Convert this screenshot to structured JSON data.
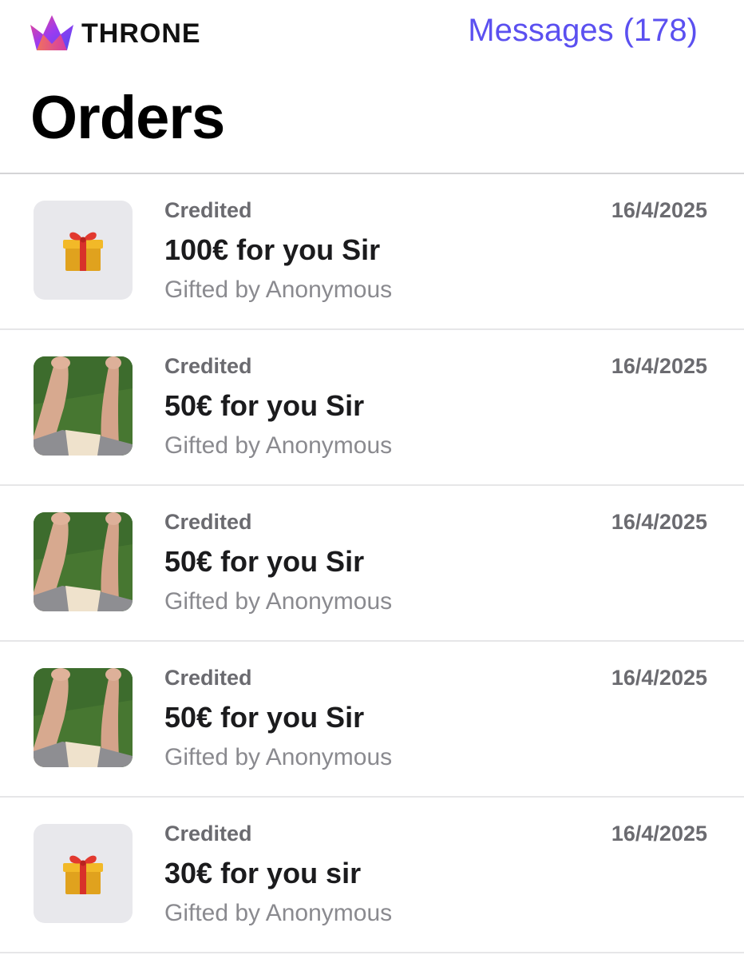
{
  "header": {
    "brand": "THRONE",
    "logo_icon": "throne-crown-logo-icon",
    "messages_label": "Messages",
    "messages_count": "(178)",
    "accent_color": "#5b50f0"
  },
  "page": {
    "title": "Orders"
  },
  "orders": [
    {
      "status": "Credited",
      "title": "100€ for you Sir",
      "gifted_by": "Gifted by Anonymous",
      "date": "16/4/2025",
      "thumbnail": "gift-icon"
    },
    {
      "status": "Credited",
      "title": "50€ for you Sir",
      "gifted_by": "Gifted by Anonymous",
      "date": "16/4/2025",
      "thumbnail": "photo-thumbnail"
    },
    {
      "status": "Credited",
      "title": "50€ for you Sir",
      "gifted_by": "Gifted by Anonymous",
      "date": "16/4/2025",
      "thumbnail": "photo-thumbnail"
    },
    {
      "status": "Credited",
      "title": "50€ for you Sir",
      "gifted_by": "Gifted by Anonymous",
      "date": "16/4/2025",
      "thumbnail": "photo-thumbnail"
    },
    {
      "status": "Credited",
      "title": "30€ for you sir",
      "gifted_by": "Gifted by Anonymous",
      "date": "16/4/2025",
      "thumbnail": "gift-icon"
    }
  ]
}
